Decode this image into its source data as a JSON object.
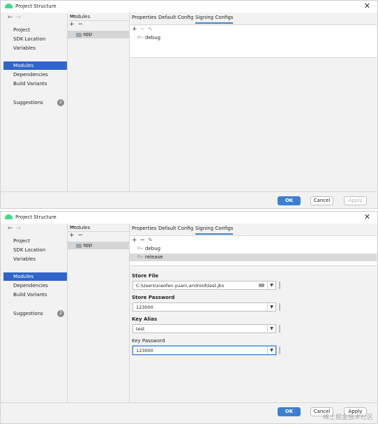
{
  "windows": [
    {
      "title": "Project Structure",
      "nav": {
        "items": [
          "Project",
          "SDK Location",
          "Variables",
          "Modules",
          "Dependencies",
          "Build Variants"
        ],
        "selected": "Modules",
        "suggestions_label": "Suggestions",
        "suggestions_count": "2"
      },
      "modules_panel": {
        "header": "Modules",
        "items": [
          "app"
        ]
      },
      "tabs": [
        "Properties",
        "Default Config",
        "Signing Configs"
      ],
      "selected_tab": "Signing Configs",
      "signing_configs": [
        "debug"
      ],
      "buttons": {
        "ok": "OK",
        "cancel": "Cancel",
        "apply": "Apply"
      }
    },
    {
      "title": "Project Structure",
      "nav": {
        "items": [
          "Project",
          "SDK Location",
          "Variables",
          "Modules",
          "Dependencies",
          "Build Variants"
        ],
        "selected": "Modules",
        "suggestions_label": "Suggestions",
        "suggestions_count": "2"
      },
      "modules_panel": {
        "header": "Modules",
        "items": [
          "app"
        ]
      },
      "tabs": [
        "Properties",
        "Default Config",
        "Signing Configs"
      ],
      "selected_tab": "Signing Configs",
      "signing_configs": [
        "debug",
        "release"
      ],
      "selected_config": "release",
      "form": {
        "store_file_label": "Store File",
        "store_file_value": "C:\\Users\\xiaofen.yuan\\.android\\test.jks",
        "store_password_label": "Store Password",
        "store_password_value": "123000",
        "key_alias_label": "Key Alias",
        "key_alias_value": "test",
        "key_password_label": "Key Password",
        "key_password_value": "123000"
      },
      "buttons": {
        "ok": "OK",
        "cancel": "Cancel",
        "apply": "Apply"
      }
    }
  ],
  "watermark": "稀土掘金技术社区",
  "icons": [
    "android-logo-icon",
    "close-icon",
    "back-arrow-icon",
    "forward-arrow-icon",
    "add-icon",
    "remove-icon",
    "edit-icon",
    "folder-icon",
    "key-icon",
    "dropdown-icon"
  ],
  "colors": {
    "selection": "#2f65ca",
    "ok_button": "#3c7fd1",
    "tab_underline": "#4083c9"
  }
}
